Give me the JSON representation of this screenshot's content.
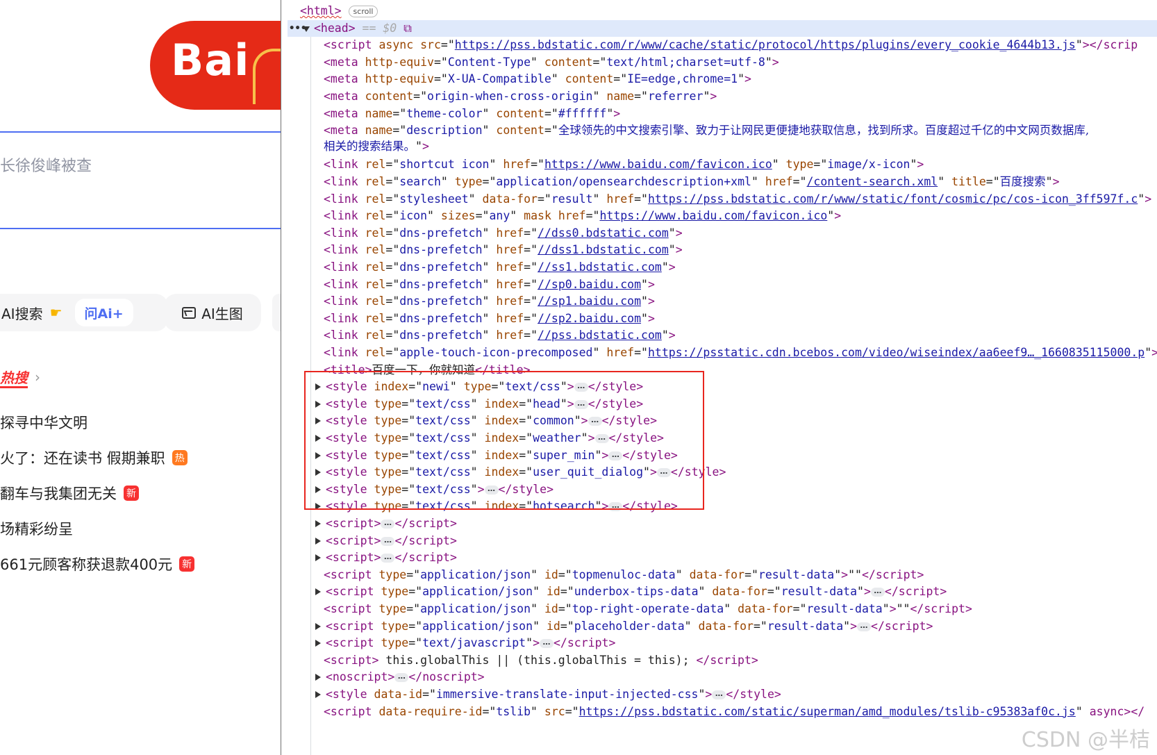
{
  "page_preview": {
    "logo_text": "Bai",
    "search_query": "长徐俊峰被查",
    "ai_search_label": "AI搜索",
    "ask_ai_label": "问Ai+",
    "ai_image_label": "AI生图",
    "hot_title": "热搜",
    "hot_items": [
      {
        "text": "探寻中华文明",
        "badge": ""
      },
      {
        "text": "火了：还在读书 假期兼职",
        "badge": "热"
      },
      {
        "text": "翻车与我集团无关",
        "badge": "新"
      },
      {
        "text": "场精彩纷呈",
        "badge": ""
      },
      {
        "text": "661元顾客称获退款400元",
        "badge": "新"
      }
    ]
  },
  "devtools": {
    "scroll_badge": "scroll",
    "head_marker": "== $0",
    "lines": [
      {
        "kind": "open",
        "tag": "html",
        "badge": "scroll"
      },
      {
        "kind": "open",
        "tag": "head",
        "selected": true
      },
      {
        "kind": "script_src",
        "attrs_pre": "async ",
        "src": "https://pss.bdstatic.com/r/www/cache/static/protocol/https/plugins/every_cookie_4644b13.js",
        "tail": "></scrip"
      },
      {
        "kind": "meta",
        "attrs": [
          [
            "http-equiv",
            "Content-Type"
          ],
          [
            "content",
            "text/html;charset=utf-8"
          ]
        ]
      },
      {
        "kind": "meta",
        "attrs": [
          [
            "http-equiv",
            "X-UA-Compatible"
          ],
          [
            "content",
            "IE=edge,chrome=1"
          ]
        ]
      },
      {
        "kind": "meta",
        "attrs": [
          [
            "content",
            "origin-when-cross-origin"
          ],
          [
            "name",
            "referrer"
          ]
        ]
      },
      {
        "kind": "meta",
        "attrs": [
          [
            "name",
            "theme-color"
          ],
          [
            "content",
            "#ffffff"
          ]
        ]
      },
      {
        "kind": "meta_desc",
        "name": "description",
        "content_a": "全球领先的中文搜索引擎、致力于让网民更便捷地获取信息，找到所求。百度超过千亿的中文网页数据库,",
        "content_b": "相关的搜索结果。"
      },
      {
        "kind": "link",
        "rel": "shortcut icon",
        "href": "https://www.baidu.com/favicon.ico",
        "after": [
          [
            "type",
            "image/x-icon"
          ]
        ]
      },
      {
        "kind": "link_pre",
        "rel": "search",
        "pre": [
          [
            "type",
            "application/opensearchdescription+xml"
          ]
        ],
        "href": "/content-search.xml",
        "after": [
          [
            "title",
            "百度搜索"
          ]
        ]
      },
      {
        "kind": "link_pre",
        "rel": "stylesheet",
        "pre": [
          [
            "data-for",
            "result"
          ]
        ],
        "href": "https://pss.bdstatic.com/r/www/static/font/cosmic/pc/cos-icon_3ff597f.c",
        "after": []
      },
      {
        "kind": "link_icon",
        "rel": "icon",
        "href": "https://www.baidu.com/favicon.ico"
      },
      {
        "kind": "link",
        "rel": "dns-prefetch",
        "href": "//dss0.bdstatic.com",
        "after": []
      },
      {
        "kind": "link",
        "rel": "dns-prefetch",
        "href": "//dss1.bdstatic.com",
        "after": []
      },
      {
        "kind": "link",
        "rel": "dns-prefetch",
        "href": "//ss1.bdstatic.com",
        "after": []
      },
      {
        "kind": "link",
        "rel": "dns-prefetch",
        "href": "//sp0.baidu.com",
        "after": []
      },
      {
        "kind": "link",
        "rel": "dns-prefetch",
        "href": "//sp1.baidu.com",
        "after": []
      },
      {
        "kind": "link",
        "rel": "dns-prefetch",
        "href": "//sp2.baidu.com",
        "after": []
      },
      {
        "kind": "link",
        "rel": "dns-prefetch",
        "href": "//pss.bdstatic.com",
        "after": []
      },
      {
        "kind": "link",
        "rel": "apple-touch-icon-precomposed",
        "href": "https://psstatic.cdn.bcebos.com/video/wiseindex/aa6eef9…_1660835115000.p",
        "after": []
      },
      {
        "kind": "title",
        "text": "百度一下，你就知道"
      },
      {
        "kind": "style",
        "attrs": [
          [
            "index",
            "newi"
          ],
          [
            "type",
            "text/css"
          ]
        ]
      },
      {
        "kind": "style",
        "attrs": [
          [
            "type",
            "text/css"
          ],
          [
            "index",
            "head"
          ]
        ]
      },
      {
        "kind": "style",
        "attrs": [
          [
            "type",
            "text/css"
          ],
          [
            "index",
            "common"
          ]
        ]
      },
      {
        "kind": "style",
        "attrs": [
          [
            "type",
            "text/css"
          ],
          [
            "index",
            "weather"
          ]
        ]
      },
      {
        "kind": "style",
        "attrs": [
          [
            "type",
            "text/css"
          ],
          [
            "index",
            "super_min"
          ]
        ]
      },
      {
        "kind": "style",
        "attrs": [
          [
            "type",
            "text/css"
          ],
          [
            "index",
            "user_quit_dialog"
          ]
        ]
      },
      {
        "kind": "style",
        "attrs": [
          [
            "type",
            "text/css"
          ]
        ]
      },
      {
        "kind": "style",
        "attrs": [
          [
            "type",
            "text/css"
          ],
          [
            "index",
            "hotsearch"
          ]
        ]
      },
      {
        "kind": "collapsed",
        "tag": "script",
        "attrs": []
      },
      {
        "kind": "collapsed",
        "tag": "script",
        "attrs": []
      },
      {
        "kind": "collapsed",
        "tag": "script",
        "attrs": []
      },
      {
        "kind": "inline",
        "tag": "script",
        "attrs": [
          [
            "type",
            "application/json"
          ],
          [
            "id",
            "topmenuloc-data"
          ],
          [
            "data-for",
            "result-data"
          ]
        ],
        "text": "\"\""
      },
      {
        "kind": "collapsed",
        "tag": "script",
        "attrs": [
          [
            "type",
            "application/json"
          ],
          [
            "id",
            "underbox-tips-data"
          ],
          [
            "data-for",
            "result-data"
          ]
        ]
      },
      {
        "kind": "inline",
        "tag": "script",
        "attrs": [
          [
            "type",
            "application/json"
          ],
          [
            "id",
            "top-right-operate-data"
          ],
          [
            "data-for",
            "result-data"
          ]
        ],
        "text": "\"\""
      },
      {
        "kind": "collapsed",
        "tag": "script",
        "attrs": [
          [
            "type",
            "application/json"
          ],
          [
            "id",
            "placeholder-data"
          ],
          [
            "data-for",
            "result-data"
          ]
        ]
      },
      {
        "kind": "collapsed",
        "tag": "script",
        "attrs": [
          [
            "type",
            "text/javascript"
          ]
        ]
      },
      {
        "kind": "inline",
        "tag": "script",
        "attrs": [],
        "text": " this.globalThis || (this.globalThis = this); "
      },
      {
        "kind": "collapsed",
        "tag": "noscript",
        "attrs": []
      },
      {
        "kind": "collapsed",
        "tag": "style",
        "attrs": [
          [
            "data-id",
            "immersive-translate-input-injected-css"
          ]
        ]
      },
      {
        "kind": "script_require",
        "require_id": "tslib",
        "src": "https://pss.bdstatic.com/static/superman/amd_modules/tslib-c95383af0c.js",
        "tail": " async></"
      }
    ]
  },
  "watermark": "CSDN @半桔"
}
